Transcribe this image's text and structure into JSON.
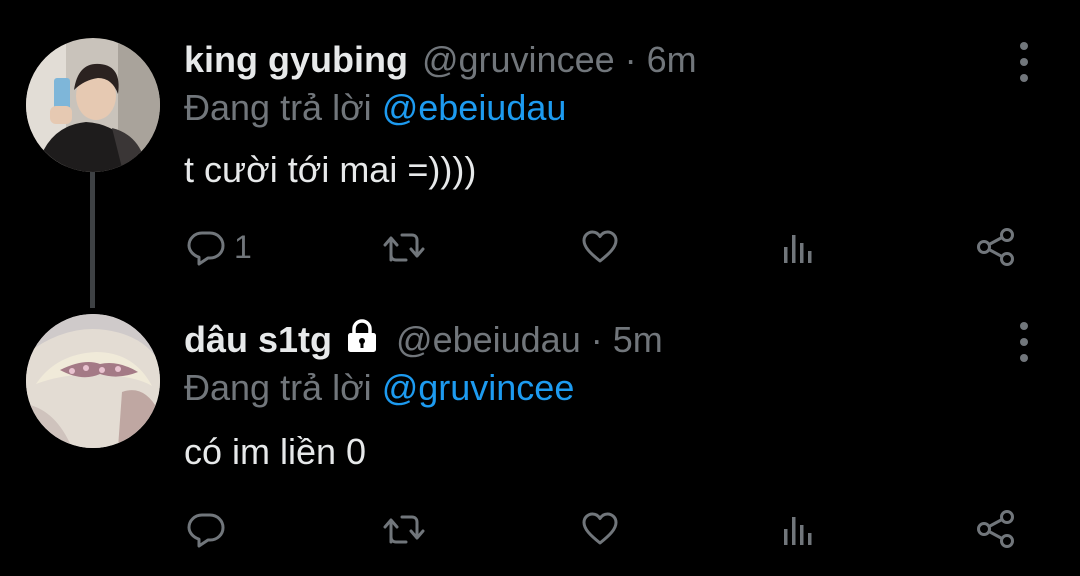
{
  "colors": {
    "background": "#000000",
    "primary_text": "#e7e9ea",
    "secondary_text": "#71767b",
    "link": "#1d9bf0",
    "thread_line": "#3e4144"
  },
  "tweets": [
    {
      "display_name": "king gyubing",
      "handle": "@gruvincee",
      "separator": "·",
      "time": "6m",
      "replying_prefix": "Đang trả lời",
      "replying_to": "@ebeiudau",
      "text": "t cười tới mai =))))",
      "reply_count": "1",
      "locked": false
    },
    {
      "display_name": "dâu s1tg",
      "handle": "@ebeiudau",
      "separator": "·",
      "time": "5m",
      "replying_prefix": "Đang trả lời",
      "replying_to": "@gruvincee",
      "text": "có im liền 0",
      "reply_count": "",
      "locked": true
    }
  ],
  "icons": {
    "reply": "reply-bubble-icon",
    "retweet": "retweet-icon",
    "like": "heart-icon",
    "views": "views-bar-chart-icon",
    "share": "share-icon",
    "more": "more-vertical-icon",
    "lock": "lock-icon"
  }
}
